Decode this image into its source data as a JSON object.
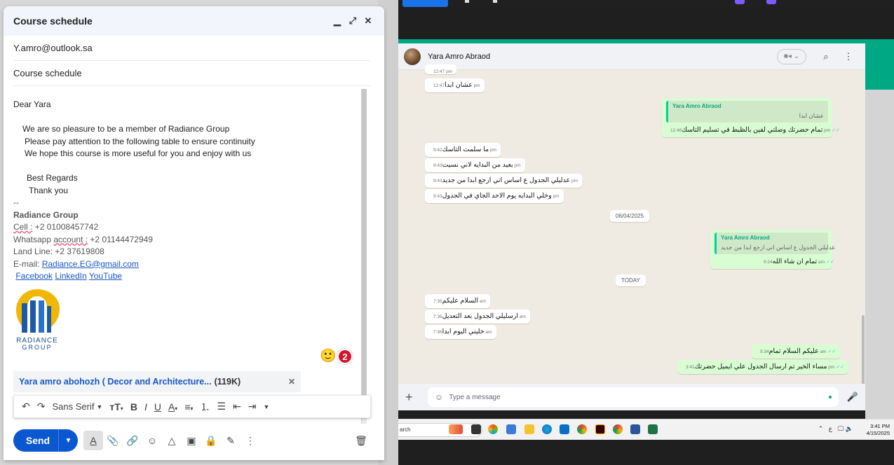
{
  "compose": {
    "title": "Course schedule",
    "to": "Y.amro@outlook.sa",
    "subject": "Course schedule",
    "body": {
      "greeting": "Dear Yara",
      "line1": "We are so pleasure to be a member of Radiance Group",
      "line2": "Please pay attention to the following table to ensure continuity",
      "line3": "We hope this course is more useful for you and enjoy with us",
      "regards": "Best Regards",
      "thanks": "Thank you",
      "sigdash": "--",
      "company": "Radiance Group",
      "cell_label": "Cell :",
      "cell_value": "+2 01008457742",
      "whatsapp_label": "Whatsapp",
      "account_label": "account :",
      "whatsapp_value": "+2 01144472949",
      "landline": "Land Line: +2 37619808",
      "email_label": "E-mail:",
      "email": "Radiance.EG@gmail.com",
      "link_facebook": "Facebook",
      "link_linkedin": "LinkedIn",
      "link_youtube": "YouTube",
      "logo_text_1": "RADIANCE",
      "logo_text_2": "GROUP"
    },
    "badge_count": "2",
    "attachment": {
      "name": "Yara amro abohozh ( Decor and Architecture...",
      "size": "(119K)"
    },
    "toolbar": {
      "font": "Sans Serif"
    },
    "send_label": "Send"
  },
  "whatsapp": {
    "contact": "Yara Amro Abraod",
    "top_partial_time": "12:47 pm",
    "messages": [
      {
        "text": "عشان ابدا",
        "time": "12:47 pm"
      },
      {
        "text": "ما سلمت التاسك",
        "time": "9:42 pm"
      },
      {
        "text": "بعيد من البدايه لاني نسيت",
        "time": "9:43 pm"
      },
      {
        "text": "عدليلي الجدول ع اساس اني ارجع ابدا من جديد",
        "time": "9:43 pm"
      },
      {
        "text": "وخلي البدايه يوم الاحد الجاي في الجدول",
        "time": "9:43 pm"
      },
      {
        "text": "السلام عليكم",
        "time": "7:36 am"
      },
      {
        "text": "ارسليلي الجدول بعد التعديل",
        "time": "7:36 am"
      },
      {
        "text": "خليني اليوم ابدا",
        "time": "7:36 am"
      }
    ],
    "reply1": {
      "quote_name": "Yara Amro Abraod",
      "quote_text": "عشان ابدا",
      "text": "تمام حضرتك وصلتي لفين بالظبط في تسليم التاسك",
      "time": "12:48 pm"
    },
    "reply2": {
      "quote_name": "Yara Amro Abraod",
      "quote_text": "عدليلي الجدول ع اساس اني ارجع ابدا من جديد",
      "text": "تمام ان شاء الله",
      "time": "9:24 am"
    },
    "out3": {
      "text": "عليكم السلام تمام",
      "time": "9:34 am"
    },
    "out4": {
      "text": "مساء الخير تم ارسال الجدول علي ايميل حضرتك",
      "time": "3:41 pm"
    },
    "date1": "06/04/2025",
    "date2": "TODAY",
    "input_placeholder": "Type a message"
  },
  "taskbar": {
    "search": "arch",
    "time": "3:41 PM",
    "date": "4/15/2025",
    "lang": "ع"
  }
}
